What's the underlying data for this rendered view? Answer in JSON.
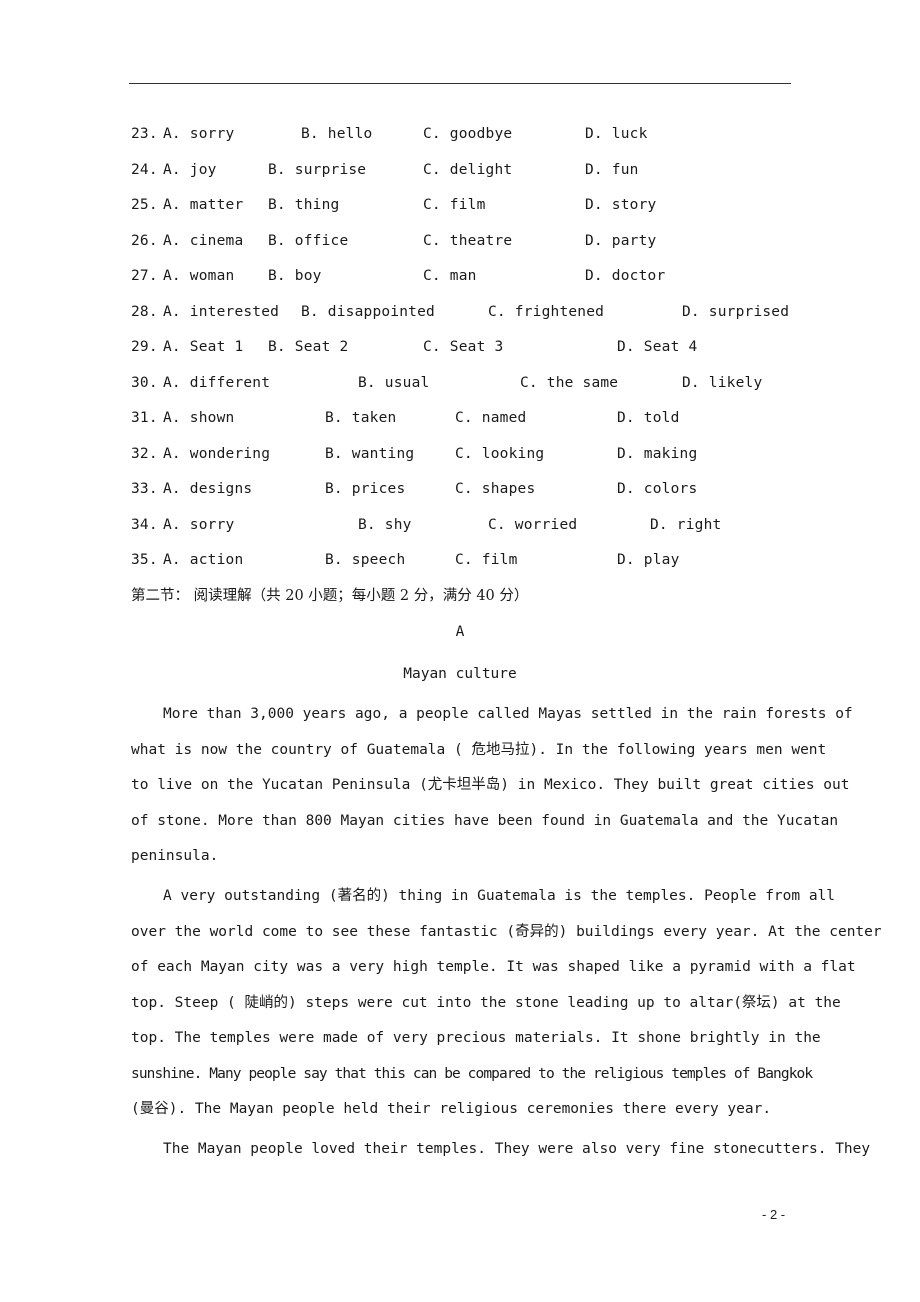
{
  "questions": [
    {
      "num": "23.",
      "options": [
        "A.  sorry",
        "B.  hello",
        "C.  goodbye",
        "D.  luck"
      ]
    },
    {
      "num": "24.",
      "options": [
        "A.  joy",
        "B.  surprise",
        "C.  delight",
        "D.  fun"
      ]
    },
    {
      "num": "25.",
      "options": [
        "A.  matter",
        "B.  thing",
        "C.  film",
        "D.  story"
      ]
    },
    {
      "num": "26.",
      "options": [
        "A.  cinema",
        "B.  office",
        "C.  theatre",
        "D.  party"
      ]
    },
    {
      "num": "27.",
      "options": [
        "A.  woman",
        "B.  boy",
        "C.  man",
        "D.  doctor"
      ]
    },
    {
      "num": "28.",
      "options": [
        "A.  interested",
        "B.  disappointed",
        "C.  frightened",
        "D.  surprised"
      ]
    },
    {
      "num": "29.",
      "options": [
        "A.  Seat 1",
        "B.  Seat 2",
        "C.  Seat 3",
        "D.  Seat 4"
      ]
    },
    {
      "num": "30.",
      "options": [
        "A.  different",
        "B.  usual",
        "C.  the same",
        "D.  likely"
      ]
    },
    {
      "num": "31.",
      "options": [
        "A.  shown",
        "B.  taken",
        "C.  named",
        "D.  told"
      ]
    },
    {
      "num": "32.",
      "options": [
        "A.  wondering",
        "B.  wanting",
        "C.  looking",
        "D.  making"
      ]
    },
    {
      "num": "33.",
      "options": [
        "A.  designs",
        "B.  prices",
        "C.  shapes",
        "D.  colors"
      ]
    },
    {
      "num": "34.",
      "options": [
        "A.  sorry",
        "B.  shy",
        "C.  worried",
        "D.  right"
      ]
    },
    {
      "num": "35.",
      "options": [
        "A.  action",
        "B.  speech",
        "C.  film",
        "D.  play"
      ]
    }
  ],
  "section_heading": "第二节： 阅读理解（共 20 小题；每小题 2 分，满分 40 分）",
  "passage": {
    "label": "A",
    "title": "Mayan culture",
    "lines": [
      "More than 3,000 years ago, a people called Mayas settled in the rain forests of",
      "what is now the country of Guatemala ( 危地马拉). In the following years men went",
      "to live on the Yucatan Peninsula (尤卡坦半岛) in Mexico. They built great cities out",
      "of stone. More than 800 Mayan cities have been found in Guatemala and the Yucatan",
      "peninsula.",
      "A very outstanding (著名的) thing in Guatemala is the temples. People from all",
      "over the world come to see these fantastic (奇异的) buildings every year. At the center",
      "of each Mayan city was a very high temple. It was shaped like a pyramid with a flat",
      "top. Steep ( 陡峭的) steps were cut into the stone leading up to altar(祭坛) at the",
      "top. The temples were made of very precious materials. It shone brightly in the",
      "sunshine. Many people say that this can be compared to the religious temples of Bangkok",
      "(曼谷). The Mayan people held their religious ceremonies there every year.",
      "The Mayan people loved their temples. They were also very fine stonecutters. They"
    ]
  },
  "page_number": "- 2 -"
}
